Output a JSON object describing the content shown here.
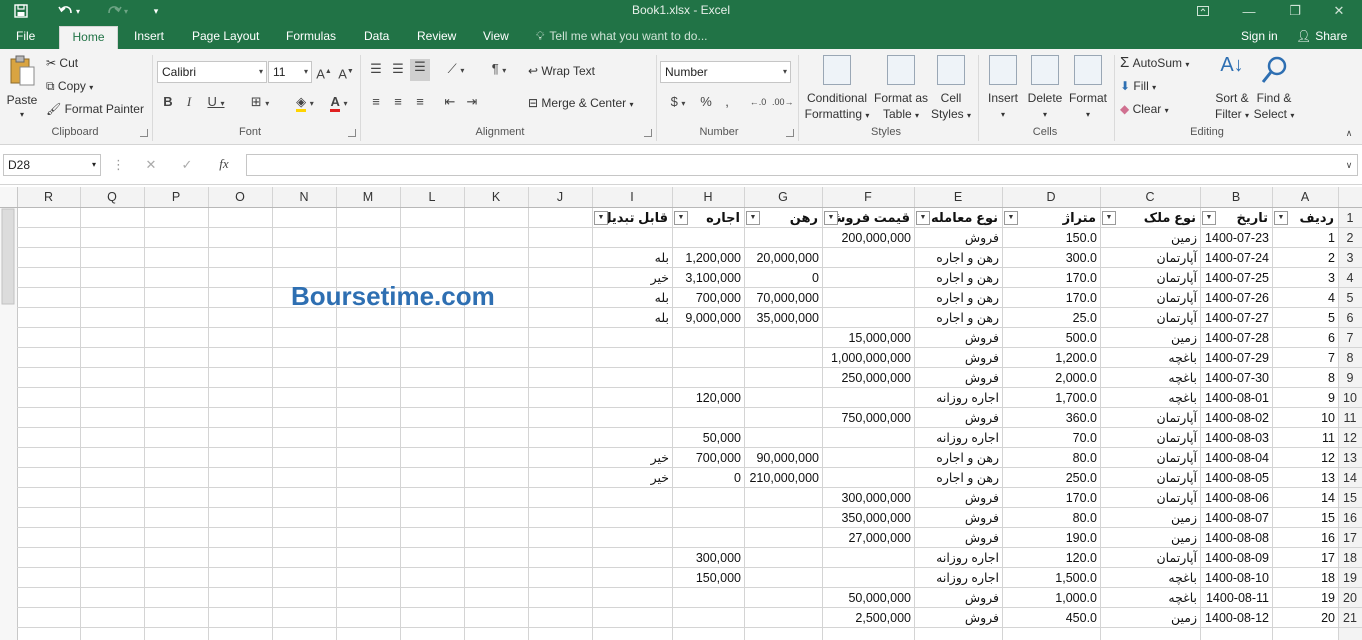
{
  "titlebar": {
    "title": "Book1.xlsx - Excel",
    "save_icon": "save-icon",
    "undo_icon": "undo-icon",
    "redo_icon": "redo-icon",
    "customize_icon": "customize-qat-icon",
    "restore_label": "ribbon-display-icon",
    "minimize_icon": "—",
    "maximize_icon": "❐",
    "close_icon": "✕"
  },
  "tabs": [
    {
      "label": "File"
    },
    {
      "label": "Home"
    },
    {
      "label": "Insert"
    },
    {
      "label": "Page Layout"
    },
    {
      "label": "Formulas"
    },
    {
      "label": "Data"
    },
    {
      "label": "Review"
    },
    {
      "label": "View"
    }
  ],
  "tellme": "Tell me what you want to do...",
  "signin": "Sign in",
  "share": "Share",
  "ribbon": {
    "clipboard": {
      "paste": "Paste",
      "cut": "Cut",
      "copy": "Copy",
      "format_painter": "Format Painter",
      "label": "Clipboard"
    },
    "font": {
      "name": "Calibri",
      "size": "11",
      "label": "Font"
    },
    "alignment": {
      "wrap": "Wrap Text",
      "merge": "Merge & Center",
      "label": "Alignment"
    },
    "number": {
      "format": "Number",
      "label": "Number"
    },
    "styles": {
      "conditional": "Conditional",
      "conditional2": "Formatting",
      "format_as": "Format as",
      "format_as2": "Table",
      "cell": "Cell",
      "cell2": "Styles",
      "label": "Styles"
    },
    "cells": {
      "insert": "Insert",
      "delete": "Delete",
      "format": "Format",
      "label": "Cells"
    },
    "editing": {
      "autosum": "AutoSum",
      "fill": "Fill",
      "clear": "Clear",
      "sort": "Sort &",
      "sort2": "Filter",
      "find": "Find &",
      "find2": "Select",
      "label": "Editing"
    }
  },
  "formulabar": {
    "namebox": "D28",
    "fx": "fx"
  },
  "columns": [
    "R",
    "Q",
    "P",
    "O",
    "N",
    "M",
    "L",
    "K",
    "J",
    "I",
    "H",
    "G",
    "F",
    "E",
    "D",
    "C",
    "B",
    "A"
  ],
  "headers": {
    "A": "ردیف",
    "B": "تاریخ",
    "C": "نوع ملک",
    "D": "متراژ",
    "E": "نوع معامله",
    "F": "قیمت فروش",
    "G": "رهن",
    "H": "اجاره",
    "I": "قابل تبدیل"
  },
  "rows": [
    {
      "A": "1",
      "B": "1400-07-23",
      "C": "زمین",
      "D": "150.0",
      "E": "فروش",
      "F": "200,000,000",
      "G": "",
      "H": "",
      "I": ""
    },
    {
      "A": "2",
      "B": "1400-07-24",
      "C": "آپارتمان",
      "D": "300.0",
      "E": "رهن و اجاره",
      "F": "",
      "G": "20,000,000",
      "H": "1,200,000",
      "I": "بله"
    },
    {
      "A": "3",
      "B": "1400-07-25",
      "C": "آپارتمان",
      "D": "170.0",
      "E": "رهن و اجاره",
      "F": "",
      "G": "0",
      "H": "3,100,000",
      "I": "خیر"
    },
    {
      "A": "4",
      "B": "1400-07-26",
      "C": "آپارتمان",
      "D": "170.0",
      "E": "رهن و اجاره",
      "F": "",
      "G": "70,000,000",
      "H": "700,000",
      "I": "بله"
    },
    {
      "A": "5",
      "B": "1400-07-27",
      "C": "آپارتمان",
      "D": "25.0",
      "E": "رهن و اجاره",
      "F": "",
      "G": "35,000,000",
      "H": "9,000,000",
      "I": "بله"
    },
    {
      "A": "6",
      "B": "1400-07-28",
      "C": "زمین",
      "D": "500.0",
      "E": "فروش",
      "F": "15,000,000",
      "G": "",
      "H": "",
      "I": ""
    },
    {
      "A": "7",
      "B": "1400-07-29",
      "C": "باغچه",
      "D": "1,200.0",
      "E": "فروش",
      "F": "1,000,000,000",
      "G": "",
      "H": "",
      "I": ""
    },
    {
      "A": "8",
      "B": "1400-07-30",
      "C": "باغچه",
      "D": "2,000.0",
      "E": "فروش",
      "F": "250,000,000",
      "G": "",
      "H": "",
      "I": ""
    },
    {
      "A": "9",
      "B": "1400-08-01",
      "C": "باغچه",
      "D": "1,700.0",
      "E": "اجاره روزانه",
      "F": "",
      "G": "",
      "H": "120,000",
      "I": ""
    },
    {
      "A": "10",
      "B": "1400-08-02",
      "C": "آپارتمان",
      "D": "360.0",
      "E": "فروش",
      "F": "750,000,000",
      "G": "",
      "H": "",
      "I": ""
    },
    {
      "A": "11",
      "B": "1400-08-03",
      "C": "آپارتمان",
      "D": "70.0",
      "E": "اجاره روزانه",
      "F": "",
      "G": "",
      "H": "50,000",
      "I": ""
    },
    {
      "A": "12",
      "B": "1400-08-04",
      "C": "آپارتمان",
      "D": "80.0",
      "E": "رهن و اجاره",
      "F": "",
      "G": "90,000,000",
      "H": "700,000",
      "I": "خیر"
    },
    {
      "A": "13",
      "B": "1400-08-05",
      "C": "آپارتمان",
      "D": "250.0",
      "E": "رهن و اجاره",
      "F": "",
      "G": "210,000,000",
      "H": "0",
      "I": "خیر"
    },
    {
      "A": "14",
      "B": "1400-08-06",
      "C": "آپارتمان",
      "D": "170.0",
      "E": "فروش",
      "F": "300,000,000",
      "G": "",
      "H": "",
      "I": ""
    },
    {
      "A": "15",
      "B": "1400-08-07",
      "C": "زمین",
      "D": "80.0",
      "E": "فروش",
      "F": "350,000,000",
      "G": "",
      "H": "",
      "I": ""
    },
    {
      "A": "16",
      "B": "1400-08-08",
      "C": "زمین",
      "D": "190.0",
      "E": "فروش",
      "F": "27,000,000",
      "G": "",
      "H": "",
      "I": ""
    },
    {
      "A": "17",
      "B": "1400-08-09",
      "C": "آپارتمان",
      "D": "120.0",
      "E": "اجاره روزانه",
      "F": "",
      "G": "",
      "H": "300,000",
      "I": ""
    },
    {
      "A": "18",
      "B": "1400-08-10",
      "C": "باغچه",
      "D": "1,500.0",
      "E": "اجاره روزانه",
      "F": "",
      "G": "",
      "H": "150,000",
      "I": ""
    },
    {
      "A": "19",
      "B": "1400-08-11",
      "C": "باغچه",
      "D": "1,000.0",
      "E": "فروش",
      "F": "50,000,000",
      "G": "",
      "H": "",
      "I": ""
    },
    {
      "A": "20",
      "B": "1400-08-12",
      "C": "زمین",
      "D": "450.0",
      "E": "فروش",
      "F": "2,500,000",
      "G": "",
      "H": "",
      "I": ""
    }
  ],
  "row_numbers": [
    "1",
    "2",
    "3",
    "4",
    "5",
    "6",
    "7",
    "8",
    "9",
    "10",
    "11",
    "12",
    "13",
    "14",
    "15",
    "16",
    "17",
    "18",
    "19",
    "20",
    "21"
  ],
  "watermark": "Boursetime.com",
  "colors": {
    "excel_green": "#217346",
    "watermark_blue": "#2e6fb2"
  }
}
